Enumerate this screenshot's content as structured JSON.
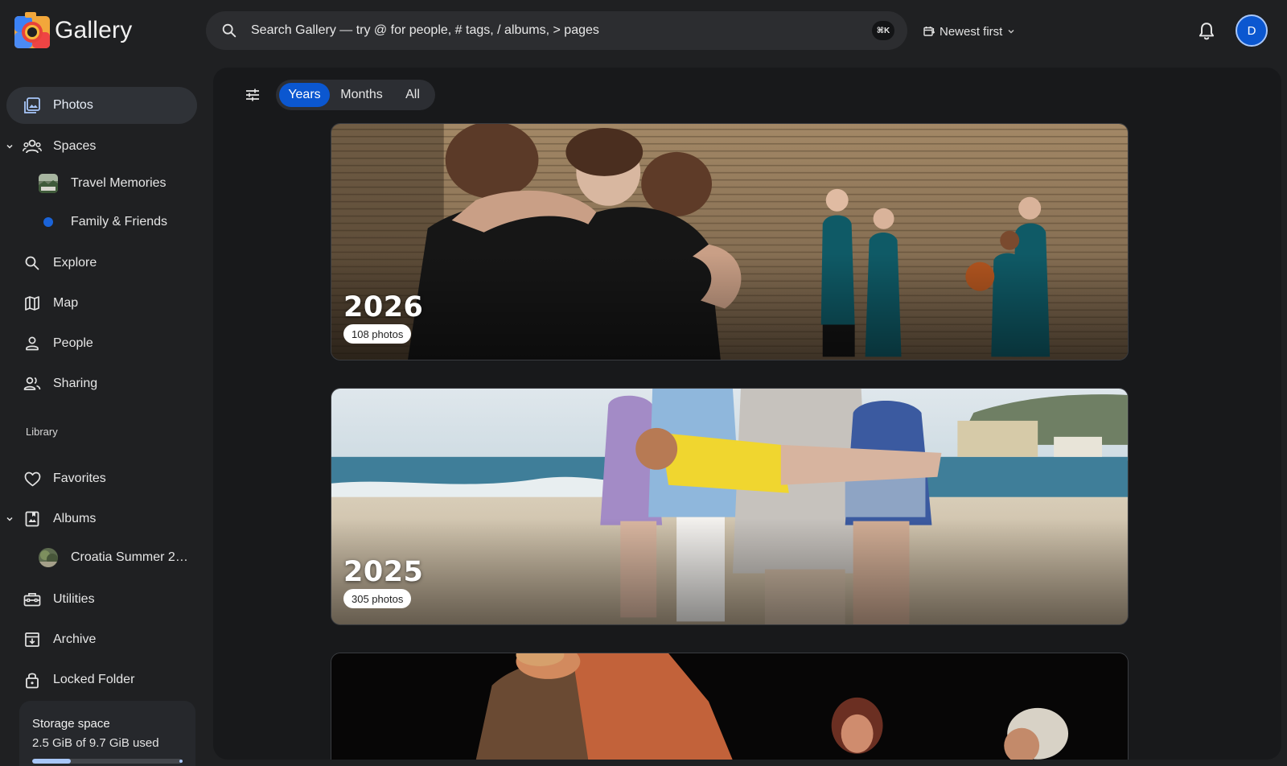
{
  "app": {
    "name": "Gallery"
  },
  "search": {
    "placeholder": "Search Gallery — try @ for people, # tags, / albums, > pages",
    "shortcut": "⌘K"
  },
  "sort": {
    "label": "Newest first"
  },
  "user": {
    "initial": "D"
  },
  "sidebar": {
    "photos": "Photos",
    "spaces": "Spaces",
    "spaces_items": [
      "Travel Memories",
      "Family & Friends"
    ],
    "explore": "Explore",
    "map": "Map",
    "people": "People",
    "sharing": "Sharing",
    "library_heading": "Library",
    "favorites": "Favorites",
    "albums": "Albums",
    "albums_items": [
      "Croatia Summer 2…"
    ],
    "utilities": "Utilities",
    "archive": "Archive",
    "locked_folder": "Locked Folder"
  },
  "storage": {
    "title": "Storage space",
    "usage_text": "2.5 GiB of 9.7 GiB used",
    "used_fraction": 0.26
  },
  "view_tabs": {
    "years": "Years",
    "months": "Months",
    "all": "All",
    "active": "Years"
  },
  "years": [
    {
      "year": "2026",
      "count": "108 photos"
    },
    {
      "year": "2025",
      "count": "305 photos"
    }
  ],
  "colors": {
    "accent": "#0b57d0",
    "accent_light": "#a8c7fa",
    "background": "#1f2022",
    "panel": "#18191b"
  }
}
